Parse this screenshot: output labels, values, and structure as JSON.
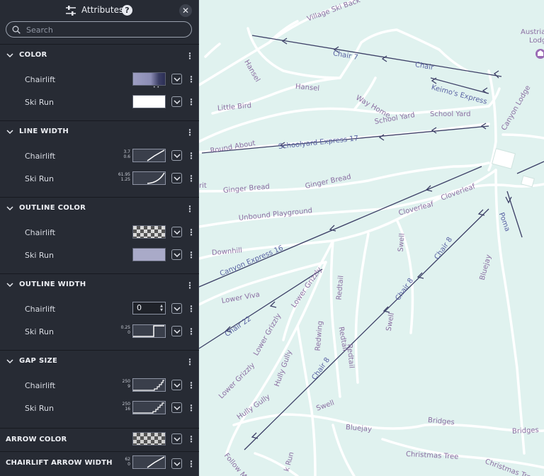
{
  "panel": {
    "title": "Attributes",
    "help_glyph": "?",
    "close_glyph": "✕",
    "search_placeholder": "Search",
    "sections": [
      {
        "title": "COLOR",
        "rows": [
          {
            "label": "Chairlift"
          },
          {
            "label": "Ski Run"
          }
        ]
      },
      {
        "title": "LINE WIDTH",
        "rows": [
          {
            "label": "Chairlift",
            "max": "3.7",
            "min": "0.6"
          },
          {
            "label": "Ski Run",
            "max": "61.95",
            "min": "1.25"
          }
        ]
      },
      {
        "title": "OUTLINE COLOR",
        "rows": [
          {
            "label": "Chairlift"
          },
          {
            "label": "Ski Run"
          }
        ]
      },
      {
        "title": "OUTLINE WIDTH",
        "rows": [
          {
            "label": "Chairlift",
            "value": "0"
          },
          {
            "label": "Ski Run",
            "max": "0.25",
            "min": "0"
          }
        ]
      },
      {
        "title": "GAP SIZE",
        "rows": [
          {
            "label": "Chairlift",
            "max": "250",
            "min": "9"
          },
          {
            "label": "Ski Run",
            "max": "250",
            "min": "16"
          }
        ]
      }
    ],
    "bottom": [
      {
        "title": "ARROW COLOR"
      },
      {
        "title": "CHAIRLIFT ARROW WIDTH",
        "max": "62",
        "min": "0"
      }
    ]
  },
  "colors": {
    "panel_bg": "#272b34",
    "map_bg": "#e0f2ef",
    "chairlift_line": "#3c3f66",
    "ski_run_color": "#ffffff",
    "outline_color": "#a9aac8",
    "label_color": "#8b6fa2"
  },
  "map": {
    "labels": {
      "village_ski_back": "Village Ski Back",
      "hansel_a": "Hansel",
      "chair7": "Chair 7",
      "chair_a": "Chair",
      "austria_a": "Austria",
      "austria_b": "Lodg",
      "hansel_b": "Hansel",
      "way_home": "Way Home",
      "keimos_express": "Keimo's Express",
      "canyon_lodge": "Canyon Lodge",
      "little_bird": "Little Bird",
      "school_yard_a": "School Yard",
      "school_yard_b": "School Yard",
      "round_about": "Round About",
      "schoolyard_express": "Schoolyard Express 17",
      "ginger_bread_a": "Ginger Bread",
      "ginger_bread_b": "Ginger Bread",
      "rit": "rit",
      "unbound_playground": "Unbound Playground",
      "cloverleaf_a": "Cloverleaf",
      "cloverleaf_b": "Cloverleaf",
      "poma": "Poma",
      "downhill": "Downhill",
      "canyon_express": "Canyon Express 16",
      "chair8_a": "Chair 8",
      "swell_a": "Swell",
      "lower_viva": "Lower Viva",
      "lower_grizzly_a": "Lower Grizzly",
      "chair8_b": "Chair 8",
      "bluejay_a": "Bluejay",
      "redtail_a": "Redtail",
      "chair22": "Chair 22",
      "redtail_b": "Redtail",
      "redtail_c": "Redtail",
      "redwing": "Redwing",
      "swell_b": "Swell",
      "lower_grizzly_b": "Lower Grizzly",
      "hully_gully_a": "Hully Gully",
      "lower_grizzly_c": "Lower Grizzly",
      "chair8_c": "Chair 8",
      "hully_gully_b": "Hully Gully",
      "swell_c": "Swell",
      "bluejay_b": "Bluejay",
      "bridges_a": "Bridges",
      "bridges_b": "Bridges",
      "follow_me": "Follow Me",
      "christmas_tree_a": "Christmas Tree",
      "christmas_tree_b": "Christmas Tree",
      "k_run": "k Run"
    }
  }
}
